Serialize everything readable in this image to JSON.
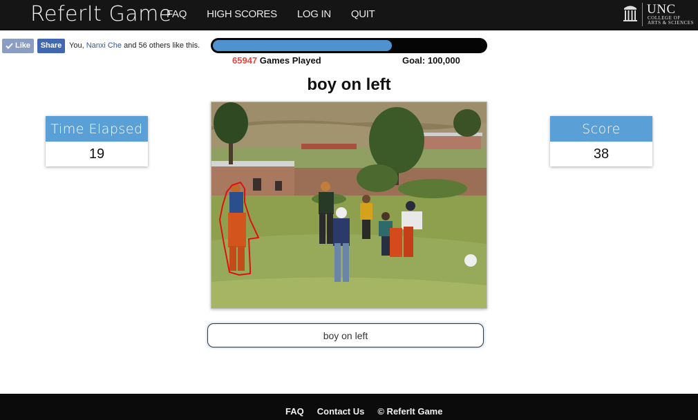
{
  "header": {
    "brand": "ReferIt Game",
    "nav": [
      "FAQ",
      "HIGH SCORES",
      "LOG IN",
      "QUIT"
    ],
    "unc_name": "UNC",
    "unc_college_line1": "COLLEGE OF",
    "unc_college_line2": "ARTS & SCIENCES"
  },
  "social": {
    "like_label": "Like",
    "share_label": "Share",
    "text_prefix": "You,",
    "friend_name": "Nanxi Che",
    "text_suffix": "and 56 others like this."
  },
  "progress": {
    "games_played": "65947",
    "games_label": "Games Played",
    "goal_label": "Goal: 100,000",
    "fraction": 0.65947
  },
  "query": {
    "text": "boy on left"
  },
  "stats": {
    "time_label": "Time Elapsed",
    "time_value": "19",
    "score_label": "Score",
    "score_value": "38"
  },
  "answer": {
    "value": "boy on left"
  },
  "footer": {
    "links": [
      "FAQ",
      "Contact Us",
      "© ReferIt Game"
    ]
  },
  "colors": {
    "accent_blue": "#5a9fd6",
    "progress_fill": "#4e93cf",
    "highlight_red": "#e8453c",
    "outline_red": "#e01010"
  }
}
